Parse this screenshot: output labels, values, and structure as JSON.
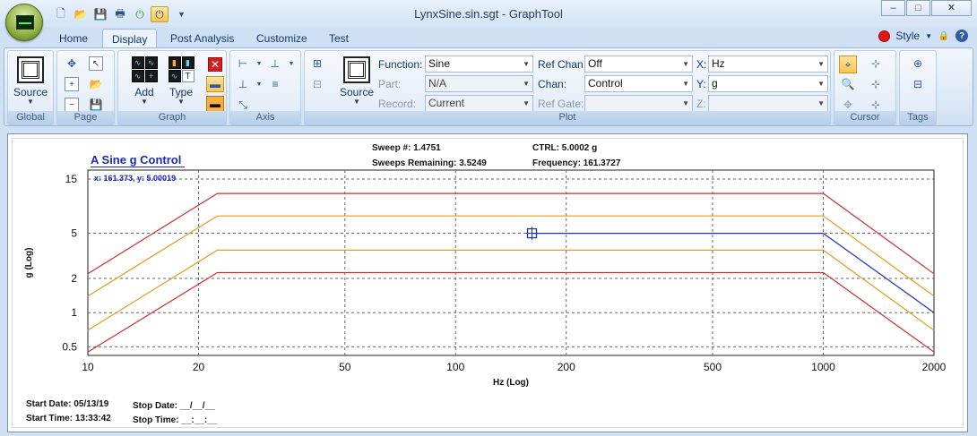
{
  "window": {
    "title": "LynxSine.sin.sgt - GraphTool",
    "controls": [
      "–",
      "□",
      "✕"
    ]
  },
  "tabs": [
    {
      "label": "Home",
      "active": false
    },
    {
      "label": "Display",
      "active": true
    },
    {
      "label": "Post Analysis",
      "active": false
    },
    {
      "label": "Customize",
      "active": false
    },
    {
      "label": "Test",
      "active": false
    }
  ],
  "style_menu": "Style",
  "ribbon": {
    "global": {
      "label": "Global",
      "source_label": "Source"
    },
    "page": {
      "label": "Page"
    },
    "graph": {
      "label": "Graph",
      "add_label": "Add",
      "type_label": "Type"
    },
    "axis": {
      "label": "Axis"
    },
    "plot": {
      "label": "Plot",
      "source_label": "Source",
      "function": {
        "label": "Function:",
        "value": "Sine"
      },
      "part": {
        "label": "Part:",
        "value": "N/A"
      },
      "record": {
        "label": "Record:",
        "value": "Current"
      },
      "ref_chan": {
        "label": "Ref Chan:",
        "value": "Off"
      },
      "chan": {
        "label": "Chan:",
        "value": "Control"
      },
      "ref_gate": {
        "label": "Ref Gate:",
        "value": ""
      },
      "x": {
        "label": "X:",
        "value": "Hz"
      },
      "y": {
        "label": "Y:",
        "value": "g"
      },
      "z": {
        "label": "Z:",
        "value": ""
      }
    },
    "cursor": {
      "label": "Cursor"
    },
    "tags": {
      "label": "Tags"
    }
  },
  "plot_panel": {
    "title": "A Sine g Control",
    "sweep": "Sweep #: 1.4751",
    "sweeps_remaining": "Sweeps Remaining: 3.5249",
    "ctrl": "CTRL: 5.0002 g",
    "frequency": "Frequency: 161.3727",
    "cursor_readout": "x: 161.373, y: 5.00019",
    "start_date": "Start Date: 05/13/19",
    "start_time": "Start Time: 13:33:42",
    "stop_date": "Stop Date: __/__/__",
    "stop_time": "Stop Time: __:__:__"
  },
  "chart_data": {
    "type": "line",
    "title": "A Sine g Control",
    "xlabel": "Hz (Log)",
    "ylabel": "g (Log)",
    "x_scale": "log",
    "y_scale": "log",
    "xlim": [
      10,
      2000
    ],
    "ylim": [
      0.42,
      18
    ],
    "x_ticks": [
      10,
      20,
      50,
      100,
      200,
      500,
      1000,
      2000
    ],
    "y_ticks": [
      0.5,
      1,
      2,
      5,
      15
    ],
    "grid": true,
    "series": [
      {
        "color": "#d22b2b",
        "points": [
          [
            10,
            2.2
          ],
          [
            22.5,
            11.2
          ],
          [
            1000,
            11.2
          ],
          [
            2000,
            2.2
          ]
        ]
      },
      {
        "color": "#e39a1e",
        "points": [
          [
            10,
            1.4
          ],
          [
            22.5,
            7.1
          ],
          [
            1000,
            7.1
          ],
          [
            2000,
            1.4
          ]
        ]
      },
      {
        "color": "#1f33b0",
        "points": [
          [
            162,
            5
          ],
          [
            1000,
            5
          ],
          [
            2000,
            1
          ]
        ]
      },
      {
        "color": "#e39a1e",
        "points": [
          [
            10,
            0.7
          ],
          [
            22.5,
            3.55
          ],
          [
            1000,
            3.55
          ],
          [
            2000,
            0.7
          ]
        ]
      },
      {
        "color": "#d22b2b",
        "points": [
          [
            10,
            0.45
          ],
          [
            22.5,
            2.25
          ],
          [
            1000,
            2.25
          ],
          [
            2000,
            0.45
          ]
        ]
      }
    ],
    "cursor": {
      "x": 161.373,
      "y": 5.00019
    }
  }
}
